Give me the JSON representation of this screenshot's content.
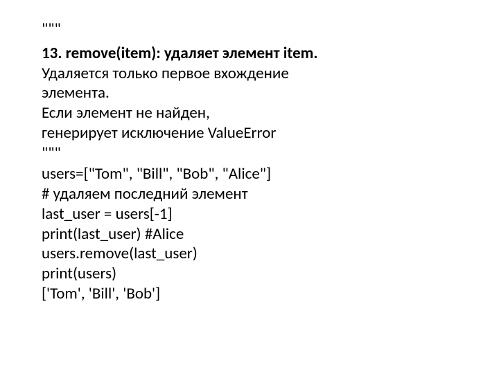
{
  "doc": {
    "quote1": "\"\"\"",
    "heading_bold_prefix": "13. remove(item): удаляет элемент item.",
    "desc1": "Удаляется только первое вхождение",
    "desc2": "элемента.",
    "desc3": "Если элемент не найден,",
    "desc4": "генерирует исключение ValueError",
    "quote2": "\"\"\"",
    "code1": "users=[\"Tom\", \"Bill\", \"Bob\", \"Alice\"]",
    "code2": "# удаляем последний элемент",
    "code3": "last_user = users[-1]",
    "code4": "print(last_user) #Alice",
    "code5": "users.remove(last_user)",
    "code6": "print(users)",
    "code7": "['Tom', 'Bill', 'Bob']"
  }
}
